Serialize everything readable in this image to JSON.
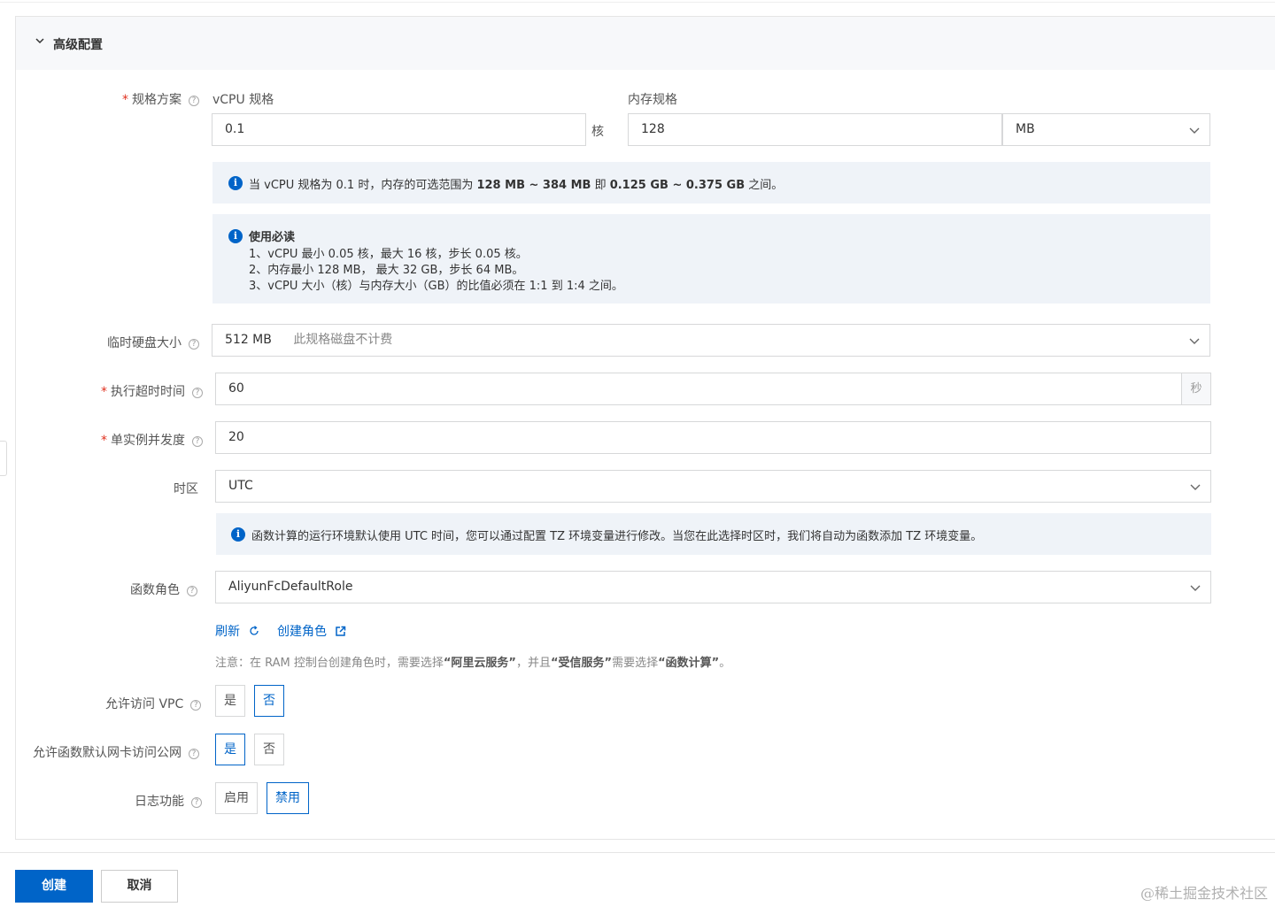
{
  "section": {
    "title": "高级配置"
  },
  "spec": {
    "label": "规格方案",
    "vcpu_label": "vCPU 规格",
    "vcpu_value": "0.1",
    "vcpu_unit": "核",
    "mem_label": "内存规格",
    "mem_value": "128",
    "mem_unit": "MB"
  },
  "spec_info": {
    "p1": "当 vCPU 规格为 0.1 时，内存的可选范围为 ",
    "b1": "128 MB ~ 384 MB",
    "p2": " 即 ",
    "b2": "0.125 GB ~ 0.375 GB",
    "p3": " 之间。"
  },
  "notice": {
    "title": "使用必读",
    "lines": [
      "1、vCPU 最小 0.05 核，最大 16 核，步长 0.05 核。",
      "2、内存最小 128 MB， 最大 32 GB，步长 64 MB。",
      "3、vCPU 大小（核）与内存大小（GB）的比值必须在 1:1 到 1:4 之间。"
    ]
  },
  "disk": {
    "label": "临时硬盘大小",
    "value": "512 MB",
    "note": "此规格磁盘不计费"
  },
  "timeout": {
    "label": "执行超时时间",
    "value": "60",
    "unit": "秒"
  },
  "concurrency": {
    "label": "单实例并发度",
    "value": "20"
  },
  "timezone": {
    "label": "时区",
    "value": "UTC",
    "info": "函数计算的运行环境默认使用 UTC 时间，您可以通过配置 TZ 环境变量进行修改。当您在此选择时区时，我们将自动为函数添加 TZ 环境变量。"
  },
  "role": {
    "label": "函数角色",
    "value": "AliyunFcDefaultRole",
    "refresh": "刷新",
    "create": "创建角色",
    "note_p1": "注意：在 RAM 控制台创建角色时，需要选择",
    "note_b1": "“阿里云服务”",
    "note_p2": "，并且",
    "note_b2": "“受信服务”",
    "note_p3": "需要选择",
    "note_b3": "“函数计算”",
    "note_p4": "。"
  },
  "vpc": {
    "label": "允许访问 VPC",
    "yes": "是",
    "no": "否",
    "selected": "no"
  },
  "internet": {
    "label": "允许函数默认网卡访问公网",
    "yes": "是",
    "no": "否",
    "selected": "yes"
  },
  "log": {
    "label": "日志功能",
    "on": "启用",
    "off": "禁用",
    "selected": "off"
  },
  "footer": {
    "create": "创建",
    "cancel": "取消"
  },
  "watermark": "@稀土掘金技术社区",
  "colors": {
    "primary": "#0064c8",
    "required": "#e0301e",
    "info_bg": "#eff3f8"
  }
}
